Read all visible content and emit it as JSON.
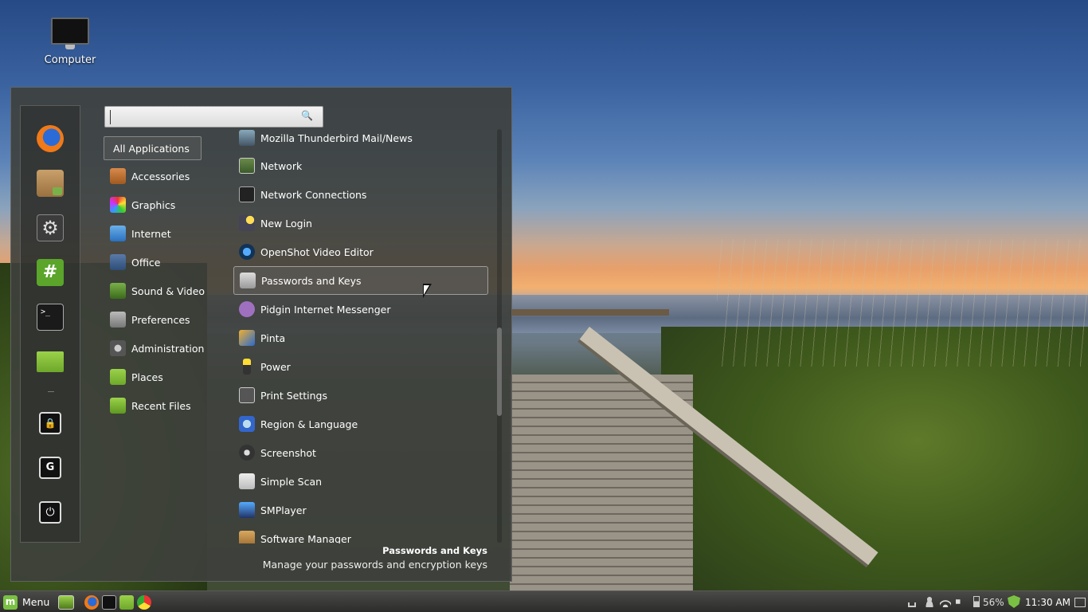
{
  "desktop": {
    "icons": [
      {
        "label": "Computer",
        "icon": "computer-icon"
      }
    ]
  },
  "menu": {
    "search": {
      "value": "",
      "placeholder": ""
    },
    "favorites": [
      "firefox-icon",
      "software-manager-icon",
      "system-settings-icon",
      "hexchat-icon",
      "terminal-icon",
      "files-icon"
    ],
    "session": [
      "lock-screen-icon",
      "logout-icon",
      "shutdown-icon"
    ],
    "categories": [
      {
        "label": "All Applications",
        "icon": "all-applications",
        "active": true
      },
      {
        "label": "Accessories",
        "icon": "accessories-icon"
      },
      {
        "label": "Graphics",
        "icon": "graphics-icon"
      },
      {
        "label": "Internet",
        "icon": "internet-icon"
      },
      {
        "label": "Office",
        "icon": "office-icon"
      },
      {
        "label": "Sound & Video",
        "icon": "sound-video-icon"
      },
      {
        "label": "Preferences",
        "icon": "preferences-icon"
      },
      {
        "label": "Administration",
        "icon": "administration-icon"
      },
      {
        "label": "Places",
        "icon": "places-folder-icon"
      },
      {
        "label": "Recent Files",
        "icon": "recent-files-folder-icon"
      }
    ],
    "applications": [
      {
        "label": "Mozilla Thunderbird Mail/News",
        "icon": "thunderbird-icon"
      },
      {
        "label": "Network",
        "icon": "network-icon"
      },
      {
        "label": "Network Connections",
        "icon": "network-connections-icon"
      },
      {
        "label": "New Login",
        "icon": "new-login-icon"
      },
      {
        "label": "OpenShot Video Editor",
        "icon": "openshot-icon"
      },
      {
        "label": "Passwords and Keys",
        "icon": "passwords-keys-icon",
        "selected": true
      },
      {
        "label": "Pidgin Internet Messenger",
        "icon": "pidgin-icon"
      },
      {
        "label": "Pinta",
        "icon": "pinta-icon"
      },
      {
        "label": "Power",
        "icon": "power-icon"
      },
      {
        "label": "Print Settings",
        "icon": "printer-icon"
      },
      {
        "label": "Region & Language",
        "icon": "region-language-icon"
      },
      {
        "label": "Screenshot",
        "icon": "screenshot-icon"
      },
      {
        "label": "Simple Scan",
        "icon": "simple-scan-icon"
      },
      {
        "label": "SMPlayer",
        "icon": "smplayer-icon"
      },
      {
        "label": "Software Manager",
        "icon": "software-manager-icon"
      }
    ],
    "description": {
      "title": "Passwords and Keys",
      "text": "Manage your passwords and encryption keys"
    }
  },
  "panel": {
    "menu_label": "Menu",
    "launchers": [
      "show-desktop-icon",
      "firefox-icon",
      "terminal-icon",
      "files-icon",
      "chrome-icon"
    ],
    "battery": "56%",
    "clock": "11:30 AM"
  }
}
